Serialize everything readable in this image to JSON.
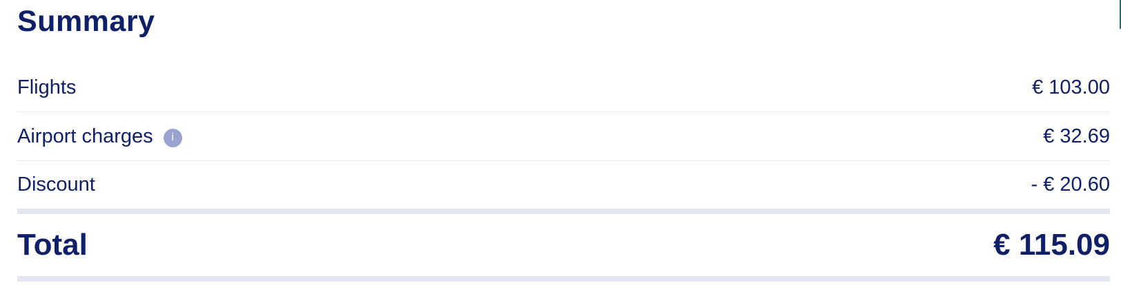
{
  "summary": {
    "title": "Summary",
    "lines": [
      {
        "label": "Flights",
        "amount": "€ 103.00"
      },
      {
        "label": "Airport charges",
        "amount": "€ 32.69",
        "info_icon": "info-icon"
      },
      {
        "label": "Discount",
        "amount": "- € 20.60"
      }
    ],
    "info_glyph": "i",
    "total_label": "Total",
    "total_amount": "€ 115.09"
  },
  "colors": {
    "text": "#0f2068",
    "divider": "#e3e6ee",
    "thick_divider": "#e3e7f1",
    "info_icon": "#98a4cf"
  }
}
